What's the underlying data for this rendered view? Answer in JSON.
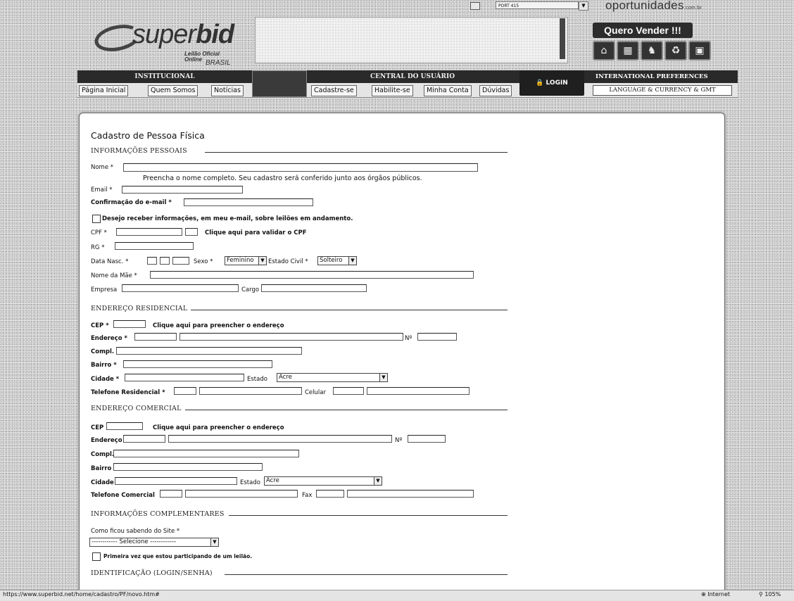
{
  "topbar": {
    "port_label": "PORT 415",
    "site_logo": "oportunidades",
    "site_logo_suffix": ".com.br"
  },
  "brand": {
    "name_plain": "super",
    "name_bold": "bid",
    "sub1": "Leilão Oficial",
    "sub2": "Online",
    "sub3": "BRASIL"
  },
  "header": {
    "quero_vender": "Quero Vender !!!"
  },
  "nav": {
    "institucional": "INSTITUCIONAL",
    "institucional_links": [
      "Página Inicial",
      "Quem Somos",
      "Notícias"
    ],
    "central": "CENTRAL DO USUÁRIO",
    "central_links": [
      "Cadastre-se",
      "Habilite-se",
      "Minha Conta",
      "Dúvidas"
    ],
    "login": "LOGIN",
    "international": "INTERNATIONAL PREFERENCES",
    "language": "LANGUAGE & CURRENCY & GMT"
  },
  "form": {
    "title": "Cadastro de Pessoa Física",
    "sections": {
      "pessoais": "INFORMAÇÕES PESSOAIS",
      "residencial": "ENDEREÇO RESIDENCIAL",
      "comercial": "ENDEREÇO COMERCIAL",
      "complementares": "INFORMAÇÕES COMPLEMENTARES",
      "identificacao": "IDENTIFICAÇÃO (LOGIN/SENHA)"
    },
    "labels": {
      "nome": "Nome *",
      "nome_hint": "Preencha o nome completo. Seu cadastro será conferido junto aos órgãos públicos.",
      "email": "Email *",
      "confirm_email": "Confirmação do e-mail *",
      "newsletter": "Desejo receber informações, em meu e-mail, sobre leilões em andamento.",
      "cpf": "CPF *",
      "cpf_link": "Clique aqui para validar o CPF",
      "rg": "RG *",
      "data_nasc": "Data Nasc. *",
      "sexo": "Sexo *",
      "estado_civil": "Estado Civil *",
      "nome_mae": "Nome da Mãe *",
      "empresa": "Empresa",
      "cargo": "Cargo",
      "cep_req": "CEP *",
      "cep": "CEP",
      "cep_link": "Clique aqui para preencher o endereço",
      "endereco_req": "Endereço *",
      "endereco": "Endereço",
      "numero": "Nº",
      "compl": "Compl.",
      "bairro_req": "Bairro *",
      "bairro": "Bairro",
      "cidade_req": "Cidade *",
      "cidade": "Cidade",
      "estado": "Estado",
      "tel_residencial": "Telefone Residencial *",
      "celular": "Celular",
      "tel_comercial": "Telefone Comercial",
      "fax": "Fax",
      "como_ficou": "Como ficou sabendo do Site *",
      "primeira_vez": "Primeira vez que estou participando de um leilão."
    },
    "values": {
      "sexo": "Feminino",
      "estado_civil": "Solteiro",
      "estado_res": "Acre",
      "estado_com": "Acre",
      "como_ficou": "------------ Selecione ------------"
    }
  },
  "statusbar": {
    "url": "https://www.superbid.net/home/cadastro/PF/novo.htm#",
    "zone": "Internet",
    "zoom": "105%"
  }
}
